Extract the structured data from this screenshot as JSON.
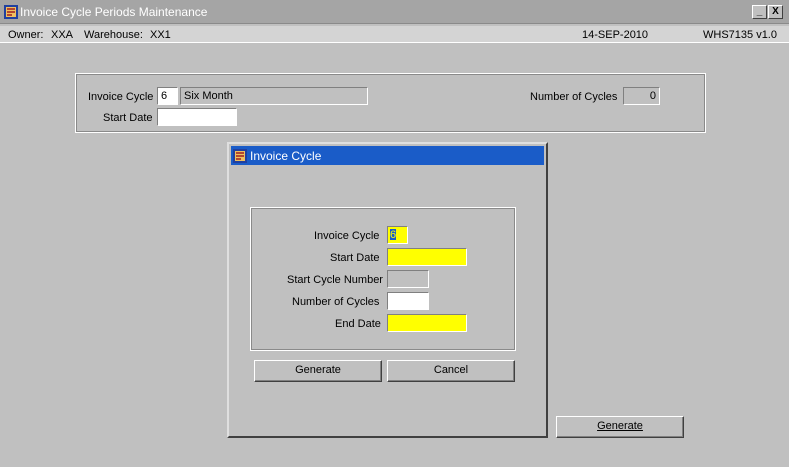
{
  "window": {
    "title": "Invoice Cycle Periods Maintenance",
    "minimize_label": "_",
    "close_label": "X"
  },
  "status": {
    "owner_label": "Owner:",
    "owner_value": "XXA",
    "warehouse_label": "Warehouse:",
    "warehouse_value": "XX1",
    "date": "14-SEP-2010",
    "version": "WHS7135  v1.0"
  },
  "main": {
    "invoice_cycle_label": "Invoice Cycle",
    "invoice_cycle_value": "6",
    "invoice_cycle_desc": "Six Month",
    "start_date_label": "Start Date",
    "start_date_value": "",
    "num_cycles_label": "Number of Cycles",
    "num_cycles_value": "0",
    "generate_label": "Generate"
  },
  "dialog": {
    "title": "Invoice Cycle",
    "invoice_cycle_label": "Invoice Cycle",
    "invoice_cycle_value": "6",
    "start_date_label": "Start Date",
    "start_date_value": "",
    "start_cycle_number_label": "Start Cycle Number",
    "start_cycle_number_value": "",
    "number_of_cycles_label": "Number of Cycles",
    "number_of_cycles_value": "",
    "end_date_label": "End Date",
    "end_date_value": "",
    "generate_label": "Generate",
    "cancel_label": "Cancel"
  },
  "colors": {
    "background": "#c0c0c0",
    "dialog_title": "#1a5cc8",
    "required_field": "#ffff00"
  },
  "icons": [
    "app-icon",
    "minimize-icon",
    "close-icon"
  ]
}
